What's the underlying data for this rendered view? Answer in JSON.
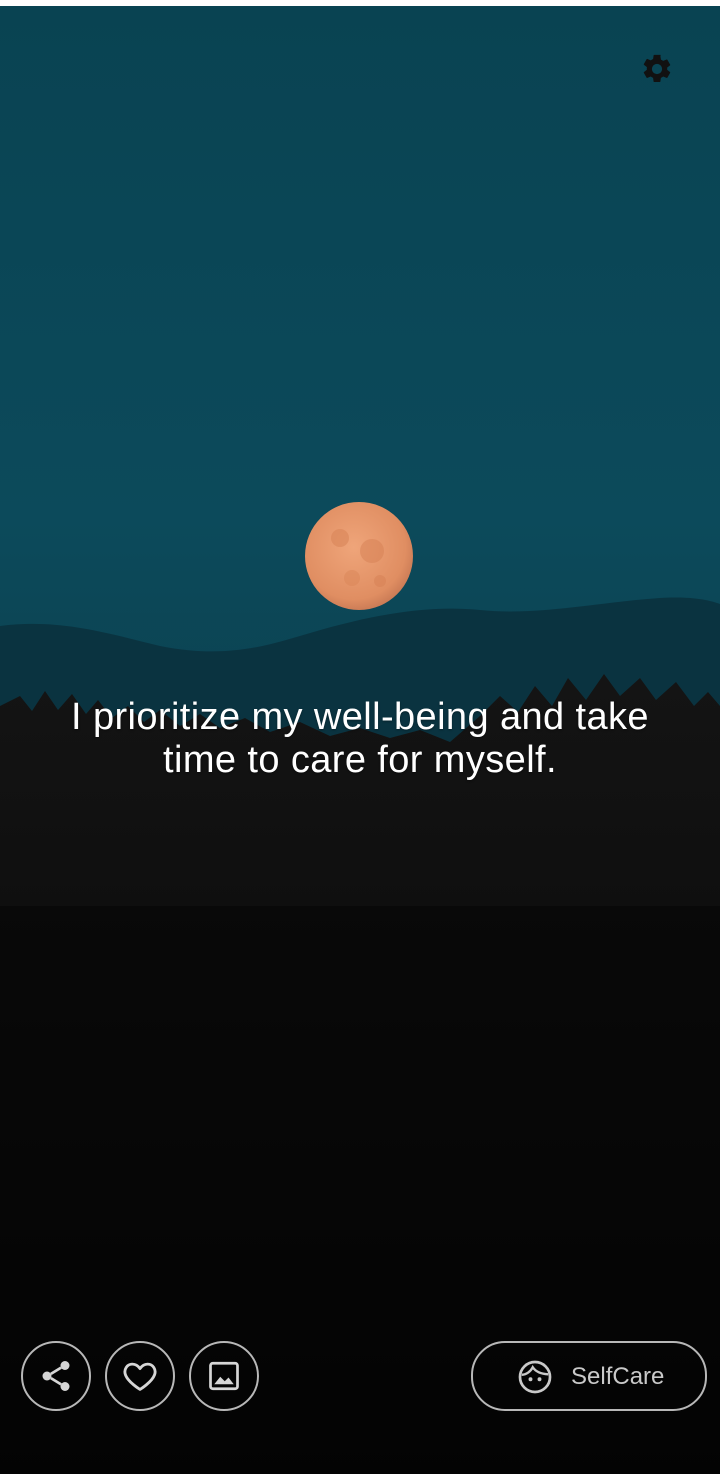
{
  "affirmation": {
    "text": "I prioritize my well-being and take time to care for myself."
  },
  "background": {
    "description_icon": "moonrise-landscape",
    "sky_color": "#0d4a5c",
    "moon_color": "#e59a6e",
    "forest_color": "#0b0b0b"
  },
  "toolbar": {
    "settings_icon": "gear-icon",
    "share_icon": "share-icon",
    "favorite_icon": "heart-icon",
    "theme_icon": "image-icon"
  },
  "category": {
    "label": "SelfCare",
    "icon": "face-icon"
  },
  "colors": {
    "button_border": "#b8b8b8",
    "text_primary": "#ffffff",
    "text_muted": "#c9c9c9"
  }
}
